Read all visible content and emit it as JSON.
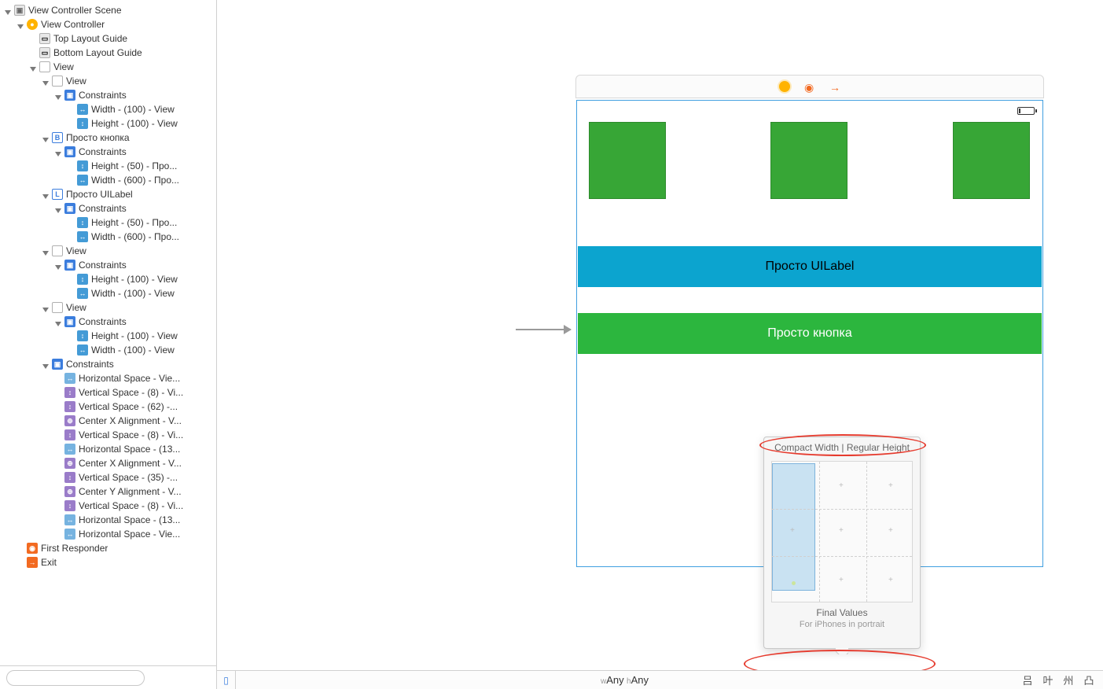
{
  "tree": {
    "scene": "View Controller Scene",
    "vc": "View Controller",
    "top_layout": "Top Layout Guide",
    "bottom_layout": "Bottom Layout Guide",
    "view": "View",
    "view2": "View",
    "constraints": "Constraints",
    "width_100_view": "Width - (100) - View",
    "height_100_view": "Height - (100) - View",
    "button": "Просто кнопка",
    "height_50_pro": "Height - (50) - Про...",
    "width_600_pro": "Width - (600) - Про...",
    "label": "Просто UILabel",
    "first_responder": "First Responder",
    "exit": "Exit",
    "hspace_vie": "Horizontal Space - Vie...",
    "vspace_8_vi": "Vertical Space - (8) - Vi...",
    "vspace_62": "Vertical Space - (62) -...",
    "centerx_v": "Center X Alignment - V...",
    "hspace_13": "Horizontal Space - (13...",
    "vspace_35": "Vertical Space - (35) -...",
    "centery_v": "Center Y Alignment - V..."
  },
  "canvas": {
    "uilabel_text": "Просто UILabel",
    "button_text": "Просто кнопка"
  },
  "popover": {
    "title": "Compact Width | Regular Height",
    "sub1": "Final Values",
    "sub2": "For iPhones in portrait"
  },
  "footer": {
    "w_prefix": "w",
    "w_val": "Any",
    "h_prefix": "h",
    "h_val": "Any"
  }
}
